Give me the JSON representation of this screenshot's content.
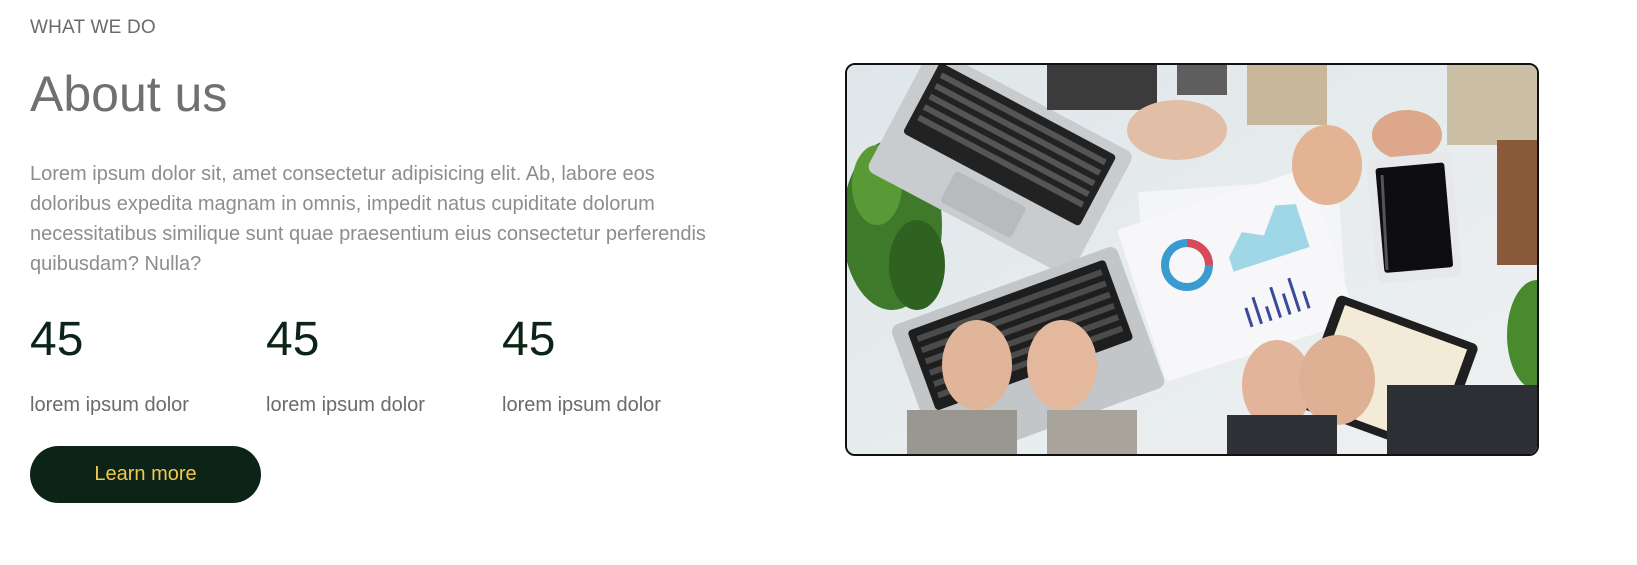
{
  "section": {
    "eyebrow": "WHAT WE DO",
    "title": "About us",
    "description": "Lorem ipsum dolor sit, amet consectetur adipisicing elit. Ab, labore eos doloribus expedita magnam in omnis, impedit natus cupiditate dolorum necessitatibus similique sunt quae praesentium eius consectetur perferendis quibusdam? Nulla?"
  },
  "stats": [
    {
      "value": "45",
      "label": "lorem ipsum dolor"
    },
    {
      "value": "45",
      "label": "lorem ipsum dolor"
    },
    {
      "value": "45",
      "label": "lorem ipsum dolor"
    }
  ],
  "cta": {
    "label": "Learn more"
  },
  "image": {
    "subject": "team-meeting-photo"
  },
  "colors": {
    "accent_dark_green": "#0c2418",
    "button_text_gold": "#f3c84b",
    "heading_gray": "#707070",
    "body_gray": "#8d8d8d"
  }
}
